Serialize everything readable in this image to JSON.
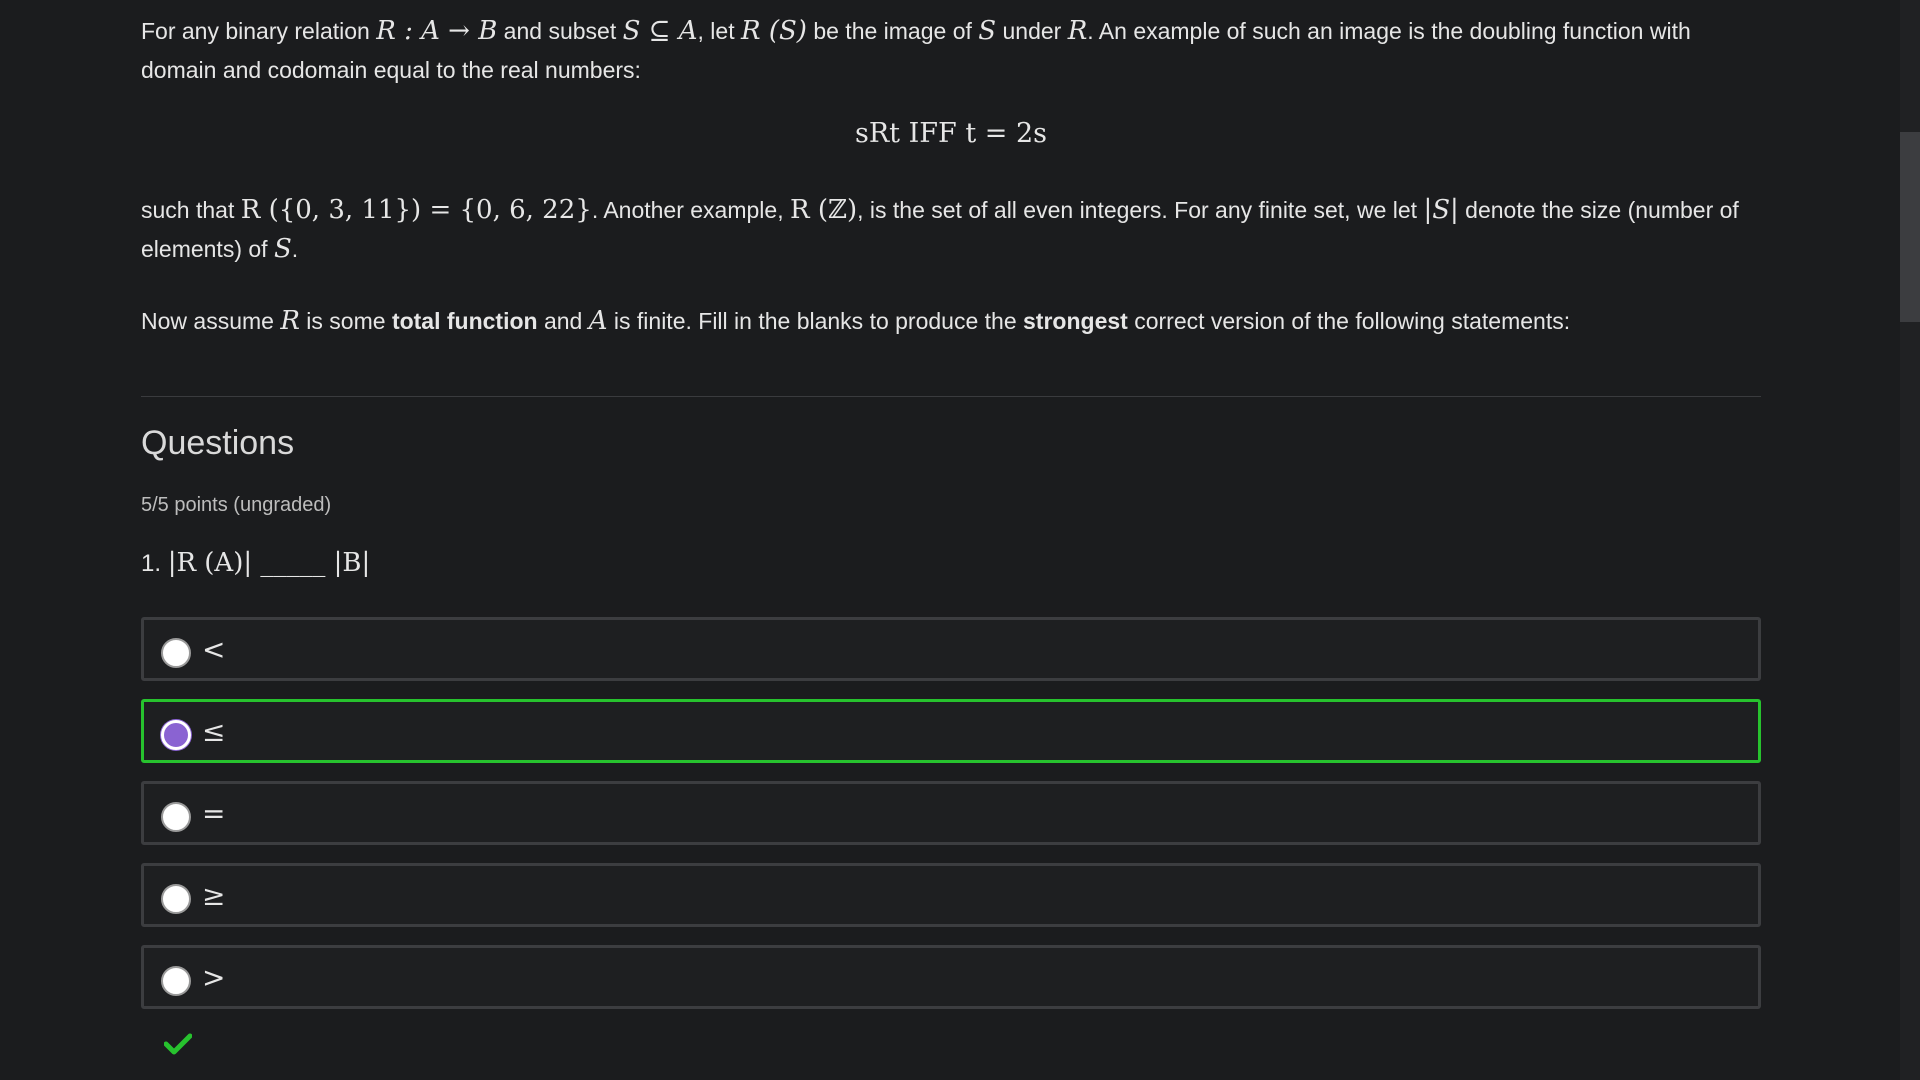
{
  "intro": {
    "p1_a": "For any binary relation ",
    "p1_m1": "R : A → B",
    "p1_b": " and subset ",
    "p1_m2": "S ⊆ A",
    "p1_c": ", let ",
    "p1_m3": "R (S)",
    "p1_d": " be the image of ",
    "p1_m4": "S",
    "p1_e": " under ",
    "p1_m5": "R",
    "p1_f": ". An example of such an image is the doubling function with domain and codomain equal to the real numbers:",
    "display_eq": "sRt IFF t = 2s",
    "p2_a": "such that ",
    "p2_m1": "R ({0, 3, 11}) = {0, 6, 22}",
    "p2_b": ". Another example, ",
    "p2_m2": "R (ℤ)",
    "p2_c": ", is the set of all even integers. For any finite set, we let ",
    "p2_m3": "|S|",
    "p2_d": " denote the size (number of elements) of ",
    "p2_m4": "S",
    "p2_e": ".",
    "p3_a": "Now assume ",
    "p3_m1": "R",
    "p3_b": " is some ",
    "p3_bold1": "total function",
    "p3_c": " and ",
    "p3_m2": "A",
    "p3_d": " is finite. Fill in the blanks to produce the ",
    "p3_bold2": "strongest",
    "p3_e": " correct version of the following statements:"
  },
  "questions": {
    "heading": "Questions",
    "points": "5/5 points (ungraded)",
    "q1_number": "1.",
    "q1_math": "|R (A)| _____ |B|"
  },
  "options": [
    {
      "label": "<",
      "selected": false
    },
    {
      "label": "≤",
      "selected": true
    },
    {
      "label": "=",
      "selected": false
    },
    {
      "label": "≥",
      "selected": false
    },
    {
      "label": ">",
      "selected": false
    }
  ],
  "colors": {
    "background": "#1b1c1e",
    "correct_border": "#27c22e",
    "selected_radio": "#8a63d2",
    "check_mark": "#27c22e"
  },
  "icons": {
    "result": "check-icon"
  }
}
